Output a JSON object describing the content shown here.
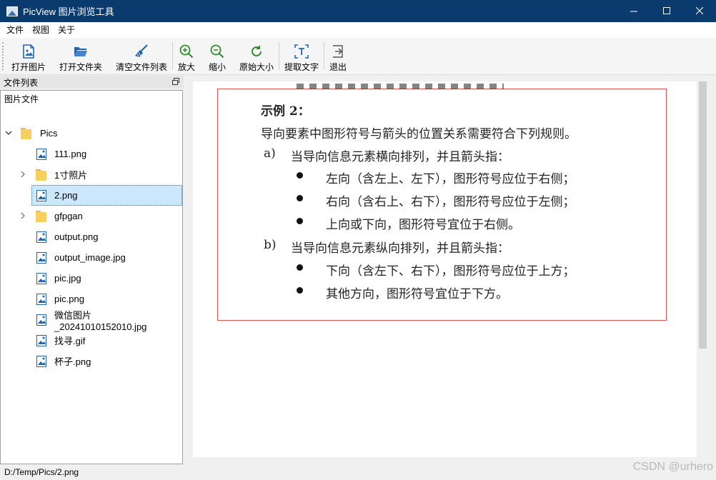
{
  "window": {
    "title": "PicView 图片浏览工具",
    "controls": [
      "minimize",
      "maximize",
      "close"
    ]
  },
  "menu": [
    "文件",
    "视图",
    "关于"
  ],
  "toolbar": {
    "open_image": "打开图片",
    "open_folder": "打开文件夹",
    "clear_list": "清空文件列表",
    "zoom_in": "放大",
    "zoom_out": "缩小",
    "original_size": "原始大小",
    "extract_text": "提取文字",
    "exit": "退出"
  },
  "dock": {
    "title": "文件列表",
    "header": "图片文件",
    "root": "Pics",
    "items": [
      {
        "label": "111.png",
        "type": "image"
      },
      {
        "label": "1寸照片",
        "type": "folder"
      },
      {
        "label": "2.png",
        "type": "image",
        "selected": true
      },
      {
        "label": "gfpgan",
        "type": "folder"
      },
      {
        "label": "output.png",
        "type": "image"
      },
      {
        "label": "output_image.jpg",
        "type": "image"
      },
      {
        "label": "pic.jpg",
        "type": "image"
      },
      {
        "label": "pic.png",
        "type": "image"
      },
      {
        "label": "微信图片_20241010152010.jpg",
        "type": "image"
      },
      {
        "label": "找寻.gif",
        "type": "image"
      },
      {
        "label": "杯子.png",
        "type": "image"
      }
    ]
  },
  "document": {
    "heading": "示例 2：",
    "intro": "导向要素中图形符号与箭头的位置关系需要符合下列规则。",
    "a_marker": "a)",
    "a_text": "当导向信息元素横向排列，并且箭头指：",
    "a_bullets": [
      "左向（含左上、左下），图形符号应位于右侧；",
      "右向（含右上、右下），图形符号应位于左侧；",
      "上向或下向，图形符号宜位于右侧。"
    ],
    "b_marker": "b)",
    "b_text": "当导向信息元素纵向排列，并且箭头指：",
    "b_bullets": [
      "下向（含左下、右下），图形符号应位于上方；",
      "其他方向，图形符号宜位于下方。"
    ]
  },
  "status": {
    "path": "D:/Temp/Pics/2.png"
  },
  "watermark": "CSDN @urhero",
  "colors": {
    "titlebar": "#0b3a6e",
    "selection": "#cce8ff",
    "doc_border": "#d9534f",
    "icon_blue": "#1f64b0",
    "icon_green": "#2e8b2e"
  }
}
